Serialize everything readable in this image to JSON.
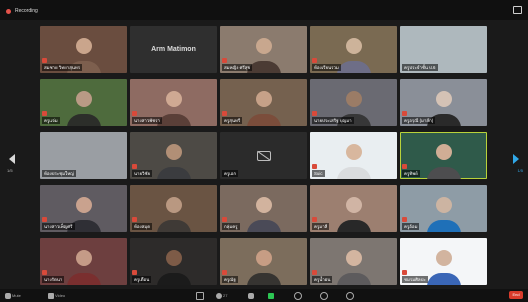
{
  "window": {
    "recording_label": "Recording",
    "page_left": "1/5",
    "page_right": "1/5"
  },
  "tiles": [
    {
      "name": "สมชาย วิทยาสุนทร",
      "theme": "#6a4d3f",
      "skin": "#caa58c",
      "shirt": "#7d5f4e",
      "style": "person"
    },
    {
      "name": "Arm Matimon",
      "theme": "#2f2f2f",
      "skin": "#2f2f2f",
      "shirt": "#2f2f2f",
      "style": "label"
    },
    {
      "name": "สมหญิง ศรีสุข",
      "theme": "#8b7b6e",
      "skin": "#c8a78e",
      "shirt": "#4b3b34",
      "style": "person"
    },
    {
      "name": "ห้องเรียนรวม",
      "theme": "#7a6a52",
      "skin": "#cdb39a",
      "shirt": "#6e6e87",
      "style": "person"
    },
    {
      "name": "ครูประจำชั้น ป.6",
      "theme": "#aeb8bd",
      "skin": "#c2c9cc",
      "shirt": "#8f989c",
      "style": "blank"
    },
    {
      "name": "ครูแจ่ม",
      "theme": "#4e6b3d",
      "skin": "#b99a85",
      "shirt": "#2c2e2a",
      "style": "person"
    },
    {
      "name": "นางสาวพัชรา",
      "theme": "#8e6b62",
      "skin": "#cfa993",
      "shirt": "#5a3f38",
      "style": "person"
    },
    {
      "name": "ครูสุนทรี",
      "theme": "#75614f",
      "skin": "#c6a188",
      "shirt": "#7b4d3b",
      "style": "person"
    },
    {
      "name": "นายประเสริฐ บุญมา",
      "theme": "#6a6a72",
      "skin": "#9b7c66",
      "shirt": "#373738",
      "style": "person"
    },
    {
      "name": "ครูอรุณี (มาส์ก)",
      "theme": "#8a8f98",
      "skin": "#d4c2b5",
      "shirt": "#2a2a2a",
      "style": "person"
    },
    {
      "name": "ห้องประชุมใหญ่",
      "theme": "#9a9ea3",
      "skin": "#c7cbcf",
      "shirt": "#81868b",
      "style": "blank"
    },
    {
      "name": "นายวิชัย",
      "theme": "#4d4a45",
      "skin": "#b18f76",
      "shirt": "#3b3c3f",
      "style": "person"
    },
    {
      "name": "ครูเอก",
      "theme": "#2b2b2b",
      "skin": "#2b2b2b",
      "shirt": "#2b2b2b",
      "style": "camoff"
    },
    {
      "name": "Suic",
      "theme": "#e9eef1",
      "skin": "#d8b79e",
      "shirt": "#dadcde",
      "style": "person"
    },
    {
      "name": "ครูทิพย์",
      "theme": "#2f5a4a",
      "skin": "#d0ad95",
      "shirt": "#4d4d4f",
      "style": "person",
      "active": true
    },
    {
      "name": "นางสาวเพ็ญศรี",
      "theme": "#5f5b61",
      "skin": "#c9a28e",
      "shirt": "#2f2f35",
      "style": "person"
    },
    {
      "name": "ห้องสมุด",
      "theme": "#6a5443",
      "skin": "#b99881",
      "shirt": "#3f3a36",
      "style": "person"
    },
    {
      "name": "กลุ่มครู",
      "theme": "#7b6a5f",
      "skin": "#d2b39e",
      "shirt": "#4a4a57",
      "style": "person"
    },
    {
      "name": "ครูมาลี",
      "theme": "#9c7f70",
      "skin": "#d0b4a4",
      "shirt": "#282828",
      "style": "person"
    },
    {
      "name": "ครูอ้อม",
      "theme": "#8e9ca6",
      "skin": "#ccb4a2",
      "shirt": "#1f70b8",
      "style": "person"
    },
    {
      "name": "นางรัตนา",
      "theme": "#6d3f3f",
      "skin": "#c59b87",
      "shirt": "#7a2f2f",
      "style": "person"
    },
    {
      "name": "ครูเดือน",
      "theme": "#2d2b2a",
      "skin": "#7d5b47",
      "shirt": "#1b1b1b",
      "style": "person"
    },
    {
      "name": "ครูณัฐ",
      "theme": "#7c6d5c",
      "skin": "#c79d84",
      "shirt": "#363431",
      "style": "person"
    },
    {
      "name": "ครูน้ำฝน",
      "theme": "#7d7671",
      "skin": "#d3b5a0",
      "shirt": "#5d5b5d",
      "style": "person"
    },
    {
      "name": "ชมรมศิลปะ",
      "theme": "#f4f6f8",
      "skin": "#d2b49f",
      "shirt": "#3a66b6",
      "style": "person"
    }
  ],
  "bottom": {
    "mic": "Mute",
    "video": "Video",
    "participants": "27",
    "chat": "Chat",
    "share": "Share",
    "record": "Record",
    "react": "Reactions",
    "more": "More",
    "end": "End"
  },
  "colors": {
    "active_border": "#b9d23a",
    "share_green": "#2cc653",
    "end_red": "#d93b2b"
  }
}
